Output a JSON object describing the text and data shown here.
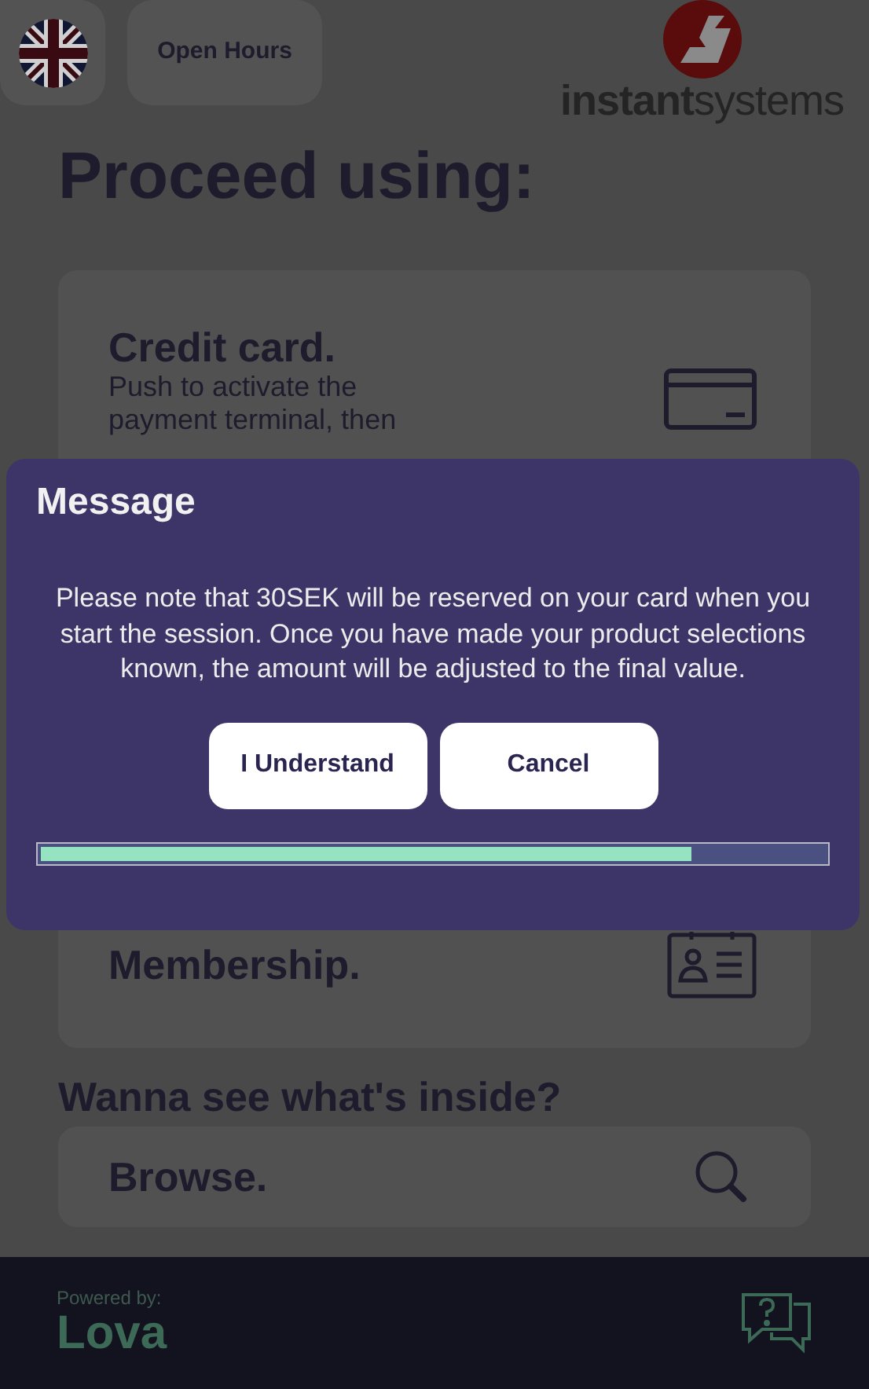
{
  "header": {
    "open_hours_button": "Open Hours",
    "logo_text": "**instant**systems"
  },
  "heading": "Proceed using:",
  "options": [
    {
      "kind": "card",
      "title": "Credit card.",
      "lines": [
        "Push to activate the",
        "payment terminal, then"
      ]
    },
    {
      "kind": "membership",
      "title": "Membership."
    }
  ],
  "browse": {
    "heading": "Wanna see what's inside?",
    "title": "Browse."
  },
  "footer": {
    "powered_by": "Powered by:",
    "brand": "Lova"
  },
  "dialog": {
    "title": "Message",
    "body": "Please note that 30SEK will be reserved on your card when you start the session. Once you have made your product selections known, the amount will be adjusted to the final value.",
    "buttons": [
      "I Understand",
      "Cancel"
    ],
    "progress": {
      "level": 0.83
    }
  }
}
